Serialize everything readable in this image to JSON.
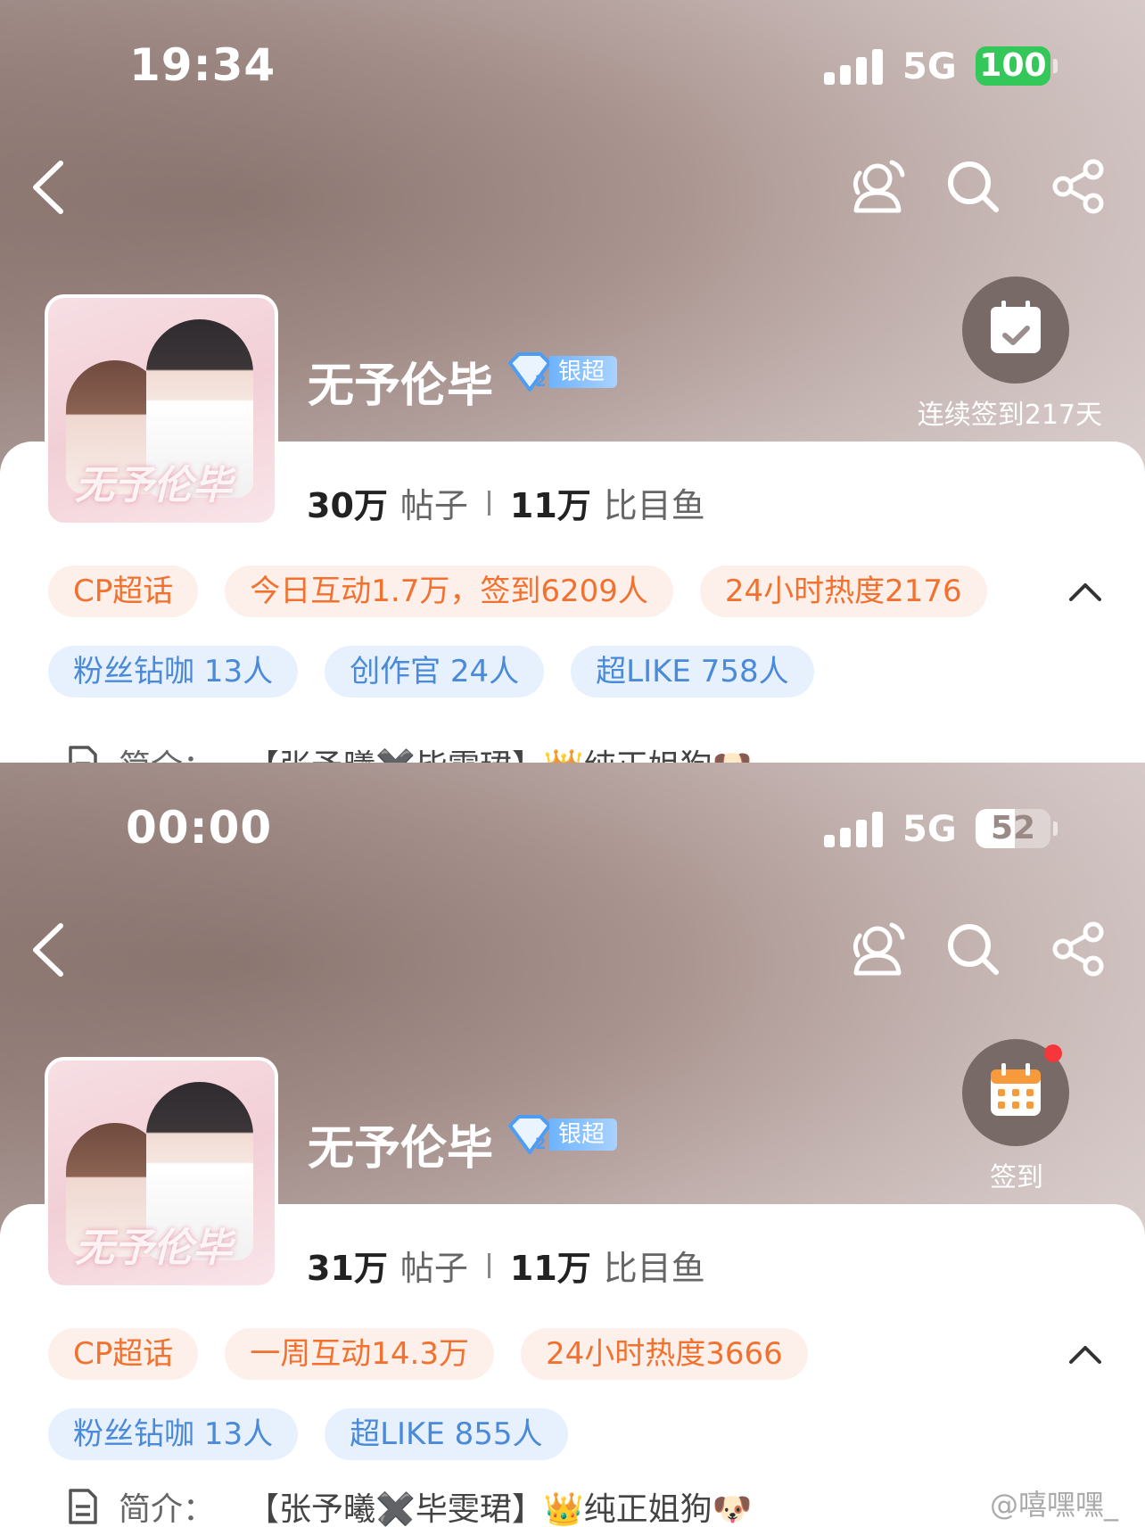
{
  "screenshots": [
    {
      "status_time": "19:34",
      "network": "5G",
      "battery": "100",
      "topic_name": "无予伦毕",
      "level_label": "银超",
      "cover_text": "无予伦毕",
      "checkin_label": "连续签到217天",
      "stats": {
        "posts_value": "30万",
        "posts_label": "帖子",
        "fans_value": "11万",
        "fans_label": "比目鱼"
      },
      "orange_chips": [
        "CP超话",
        "今日互动1.7万，签到6209人",
        "24小时热度2176"
      ],
      "blue_chips": [
        "粉丝钻咖 13人",
        "创作官 24人",
        "超LIKE 758人"
      ],
      "intro": {
        "label": "简介：",
        "text": "【张予曦✖️毕雯珺】👑纯正姐狗🐶"
      }
    },
    {
      "status_time": "00:00",
      "network": "5G",
      "battery": "52",
      "topic_name": "无予伦毕",
      "level_label": "银超",
      "cover_text": "无予伦毕",
      "checkin_label": "签到",
      "stats": {
        "posts_value": "31万",
        "posts_label": "帖子",
        "fans_value": "11万",
        "fans_label": "比目鱼"
      },
      "orange_chips": [
        "CP超话",
        "一周互动14.3万",
        "24小时热度3666"
      ],
      "blue_chips": [
        "粉丝钻咖 13人",
        "超LIKE 855人"
      ],
      "intro": {
        "label": "简介：",
        "text": "【张予曦✖️毕雯珺】👑纯正姐狗🐶"
      }
    }
  ],
  "watermark": "@嘻嘿嘿_",
  "colors": {
    "orange_chip_text": "#f2712f",
    "blue_chip_text": "#4a8ad8",
    "battery_green": "#34c759",
    "badge_red": "#f5363b"
  }
}
